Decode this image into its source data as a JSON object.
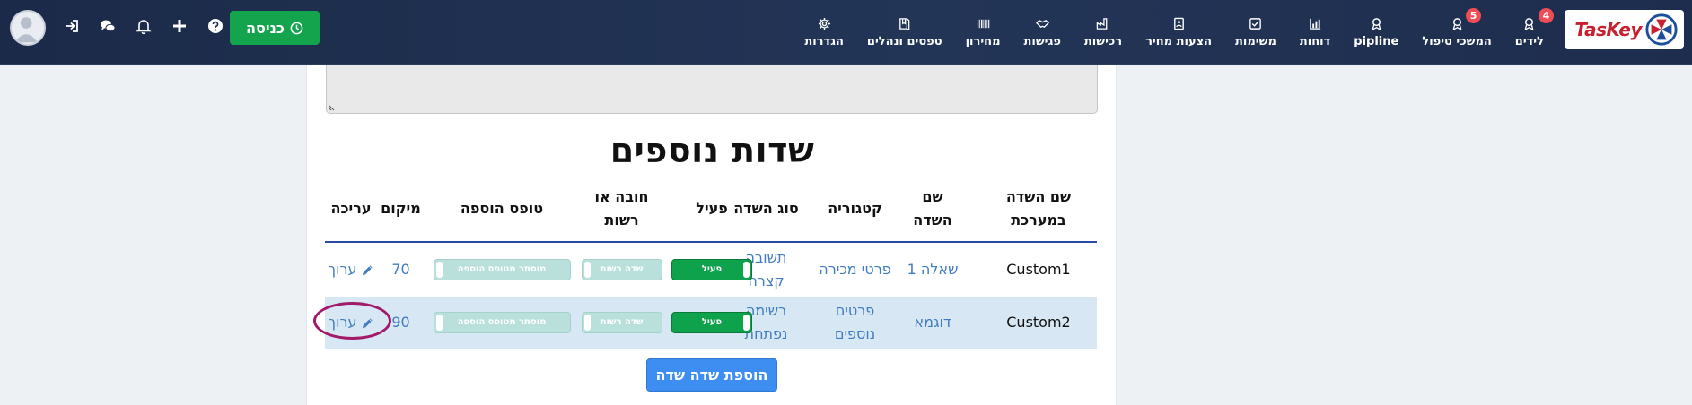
{
  "navbar": {
    "logo_text": "TasKey",
    "items": [
      {
        "label": "לידים",
        "icon": "award-icon",
        "badge": "4"
      },
      {
        "label": "המשכי טיפול",
        "icon": "award-icon",
        "badge": "5"
      },
      {
        "label": "pipline",
        "icon": "award-icon",
        "badge": ""
      },
      {
        "label": "דוחות",
        "icon": "bar-chart-icon",
        "badge": ""
      },
      {
        "label": "משימות",
        "icon": "check-square-icon",
        "badge": ""
      },
      {
        "label": "הצעות מחיר",
        "icon": "document-icon",
        "badge": ""
      },
      {
        "label": "רכישות",
        "icon": "factory-icon",
        "badge": ""
      },
      {
        "label": "פגישות",
        "icon": "handshake-icon",
        "badge": ""
      },
      {
        "label": "מחירון",
        "icon": "barcode-icon",
        "badge": ""
      },
      {
        "label": "טפסים ונהלים",
        "icon": "book-icon",
        "badge": ""
      },
      {
        "label": "הגדרות",
        "icon": "gear-icon",
        "badge": ""
      }
    ],
    "entry_button": "כניסה",
    "utility_icons": [
      "sign-in-icon",
      "chat-icon",
      "bell-icon",
      "plus-icon",
      "help-icon"
    ]
  },
  "section": {
    "title": "שדות נוספים"
  },
  "table": {
    "headers": {
      "system_name": "שם השדה במערכת",
      "field_name": "שם השדה",
      "category": "קטגוריה",
      "field_type": "סוג השדה",
      "active": "פעיל",
      "required": "חובה או רשות",
      "add_form": "טופס הוספה",
      "position": "מיקום",
      "edit": "עריכה"
    },
    "rows": [
      {
        "system_name": "Custom1",
        "field_name": "שאלה 1",
        "category": "פרטי מכירה",
        "field_type": "תשובה קצרה",
        "active": "פעיל",
        "required": "שדה רשות",
        "add_form": "מוסתר מטופס הוספה",
        "position": "70",
        "edit": "ערוך"
      },
      {
        "system_name": "Custom2",
        "field_name": "דוגמא",
        "category": "פרטים נוספים",
        "field_type": "רשימה נפתחת",
        "active": "פעיל",
        "required": "שדה רשות",
        "add_form": "מוסתר מטופס הוספה",
        "position": "90",
        "edit": "ערוך"
      }
    ]
  },
  "add_button": "הוספת שדה שדה",
  "colors": {
    "navbar": "#1e2d4d",
    "entry_button": "#14a44d",
    "toggle_on": "#0ea24d",
    "toggle_off": "#b9e0da",
    "link": "#3f7cc0",
    "row_highlight": "#d7e7f4",
    "annotation_ring": "#a21a6a",
    "add_button": "#3d8ef0"
  }
}
